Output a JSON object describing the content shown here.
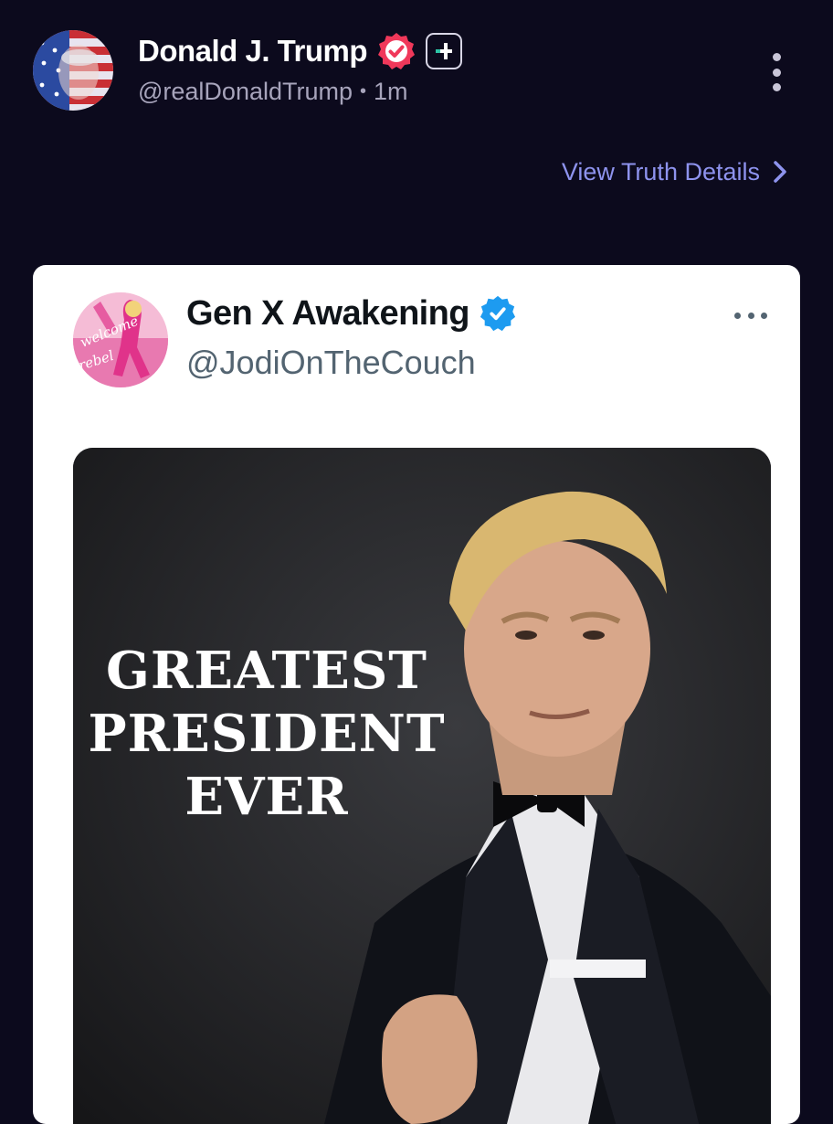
{
  "post": {
    "author_name": "Donald J. Trump",
    "handle": "@realDonaldTrump",
    "separator": "•",
    "time_ago": "1m",
    "details_link": "View Truth Details"
  },
  "embed": {
    "author_name": "Gen X Awakening",
    "handle": "@JodiOnTheCouch",
    "image_caption": [
      "GREATEST",
      "PRESIDENT",
      "EVER"
    ],
    "avatar_text": [
      "welcome",
      "rebel"
    ]
  },
  "icons": {
    "verified_badge": "verified-icon",
    "plus_badge": "plus-icon",
    "more_menu": "vertical-ellipsis-icon",
    "details_chevron": "chevron-right-icon",
    "embed_verified": "verified-icon",
    "embed_more": "horizontal-ellipsis-icon"
  },
  "colors": {
    "background": "#0c0a1d",
    "truth_verified": "#f0385a",
    "link": "#8e93ee",
    "tw_verified": "#1d9bf0"
  }
}
